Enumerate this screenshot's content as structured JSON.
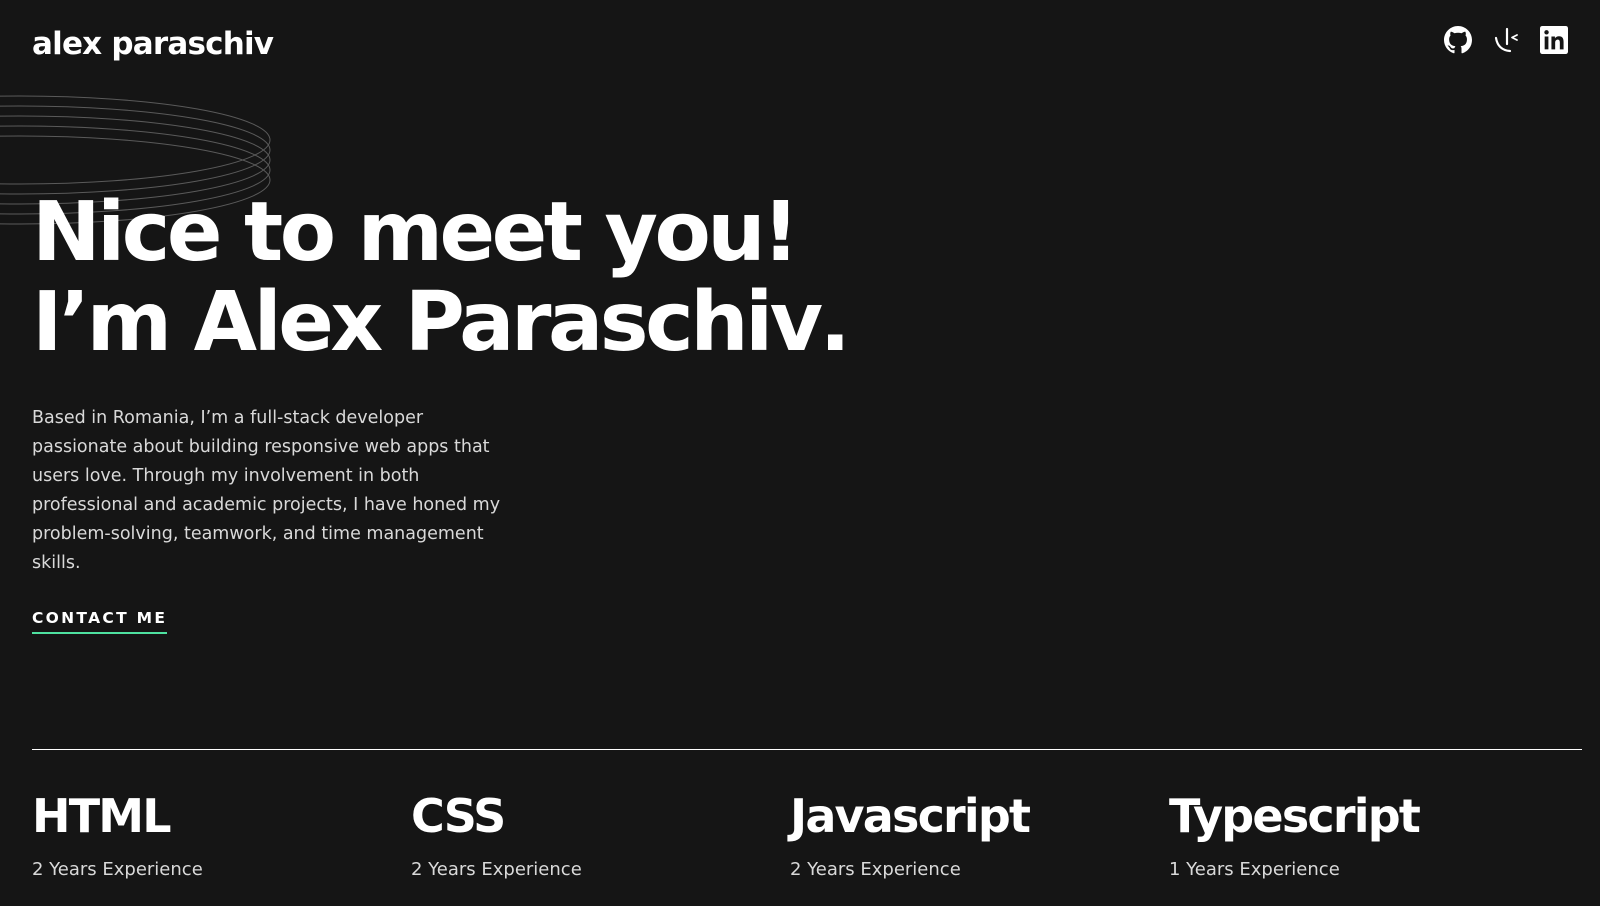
{
  "header": {
    "logo": "alex paraschiv",
    "socials": [
      {
        "name": "github",
        "icon": "github-icon"
      },
      {
        "name": "frontend-mentor",
        "icon": "frontend-mentor-icon"
      },
      {
        "name": "linkedin",
        "icon": "linkedin-icon"
      }
    ]
  },
  "hero": {
    "line1": "Nice to meet you!",
    "line2_prefix": "I’m ",
    "name": "Alex Paraschiv",
    "line2_suffix": ".",
    "bio": "Based in Romania, I’m a full-stack developer passionate about building responsive web apps that users love. Through my involvement in both professional and academic projects, I have honed my problem-solving, teamwork, and time management skills.",
    "cta": "CONTACT ME"
  },
  "skills": [
    {
      "name": "HTML",
      "experience": "2 Years Experience"
    },
    {
      "name": "CSS",
      "experience": "2 Years Experience"
    },
    {
      "name": "Javascript",
      "experience": "2 Years Experience"
    },
    {
      "name": "Typescript",
      "experience": "1 Years Experience"
    }
  ],
  "colors": {
    "background": "#151515",
    "accent": "#4ee1a0",
    "text": "#ffffff",
    "muted_text": "#d9d9d9"
  }
}
